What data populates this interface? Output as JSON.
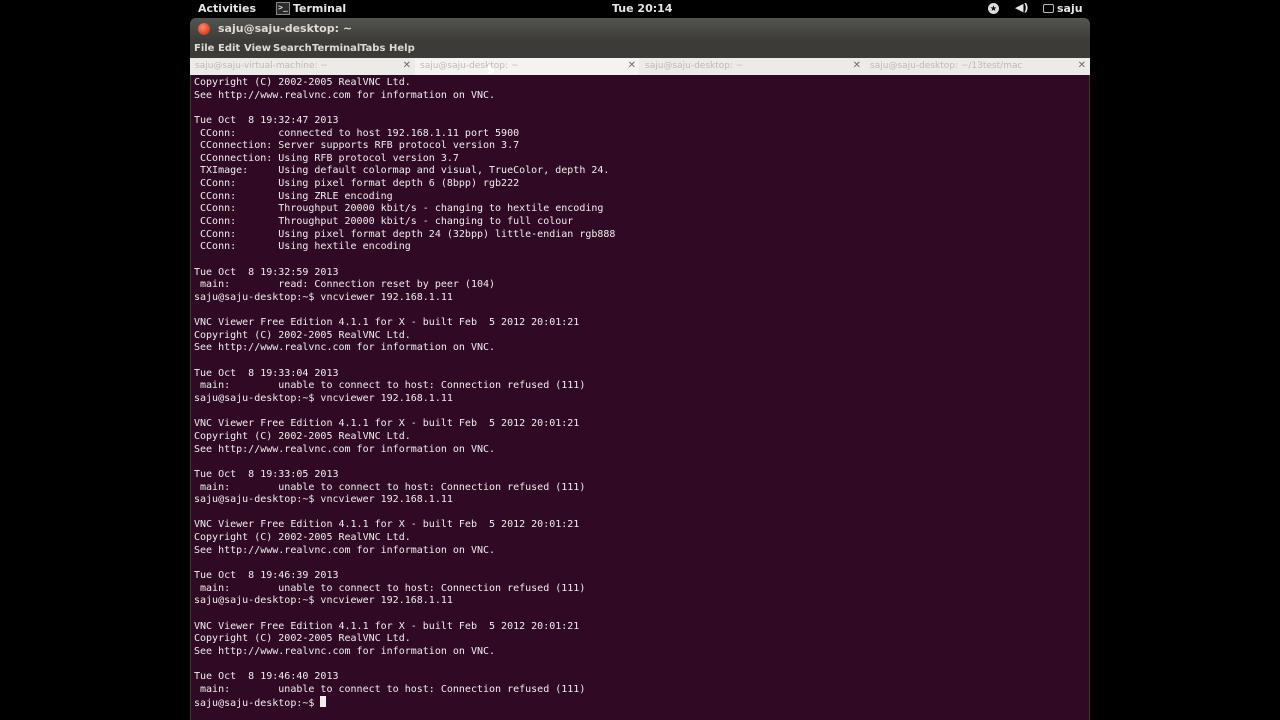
{
  "topbar": {
    "activities": "Activities",
    "app_name": "Terminal",
    "app_icon": "terminal-icon",
    "clock": "Tue 20:14",
    "accessibility_icon": "accessibility-icon",
    "volume_icon": "volume-icon",
    "user_name": "saju",
    "user_icon": "user-icon"
  },
  "window": {
    "title": "saju@saju-desktop: ~",
    "menu": [
      "File",
      "Edit",
      "View",
      "Search",
      "Terminal",
      "Tabs",
      "Help"
    ],
    "tabs": [
      {
        "label": "saju@saju-virtual-machine: ~",
        "active": false
      },
      {
        "label": "saju@saju-desktop: ~",
        "active": true
      },
      {
        "label": "saju@saju-desktop: ~",
        "active": false
      },
      {
        "label": "saju@saju-desktop: ~/13test/mac",
        "active": false
      }
    ]
  },
  "terminal": {
    "background": "#300a24",
    "foreground": "#eeeeec",
    "lines": [
      "Copyright (C) 2002-2005 RealVNC Ltd.",
      "See http://www.realvnc.com for information on VNC.",
      "",
      "Tue Oct  8 19:32:47 2013",
      " CConn:       connected to host 192.168.1.11 port 5900",
      " CConnection: Server supports RFB protocol version 3.7",
      " CConnection: Using RFB protocol version 3.7",
      " TXImage:     Using default colormap and visual, TrueColor, depth 24.",
      " CConn:       Using pixel format depth 6 (8bpp) rgb222",
      " CConn:       Using ZRLE encoding",
      " CConn:       Throughput 20000 kbit/s - changing to hextile encoding",
      " CConn:       Throughput 20000 kbit/s - changing to full colour",
      " CConn:       Using pixel format depth 24 (32bpp) little-endian rgb888",
      " CConn:       Using hextile encoding",
      "",
      "Tue Oct  8 19:32:59 2013",
      " main:        read: Connection reset by peer (104)",
      "saju@saju-desktop:~$ vncviewer 192.168.1.11",
      "",
      "VNC Viewer Free Edition 4.1.1 for X - built Feb  5 2012 20:01:21",
      "Copyright (C) 2002-2005 RealVNC Ltd.",
      "See http://www.realvnc.com for information on VNC.",
      "",
      "Tue Oct  8 19:33:04 2013",
      " main:        unable to connect to host: Connection refused (111)",
      "saju@saju-desktop:~$ vncviewer 192.168.1.11",
      "",
      "VNC Viewer Free Edition 4.1.1 for X - built Feb  5 2012 20:01:21",
      "Copyright (C) 2002-2005 RealVNC Ltd.",
      "See http://www.realvnc.com for information on VNC.",
      "",
      "Tue Oct  8 19:33:05 2013",
      " main:        unable to connect to host: Connection refused (111)",
      "saju@saju-desktop:~$ vncviewer 192.168.1.11",
      "",
      "VNC Viewer Free Edition 4.1.1 for X - built Feb  5 2012 20:01:21",
      "Copyright (C) 2002-2005 RealVNC Ltd.",
      "See http://www.realvnc.com for information on VNC.",
      "",
      "Tue Oct  8 19:46:39 2013",
      " main:        unable to connect to host: Connection refused (111)",
      "saju@saju-desktop:~$ vncviewer 192.168.1.11",
      "",
      "VNC Viewer Free Edition 4.1.1 for X - built Feb  5 2012 20:01:21",
      "Copyright (C) 2002-2005 RealVNC Ltd.",
      "See http://www.realvnc.com for information on VNC.",
      "",
      "Tue Oct  8 19:46:40 2013",
      " main:        unable to connect to host: Connection refused (111)"
    ],
    "prompt": "saju@saju-desktop:~$ "
  }
}
